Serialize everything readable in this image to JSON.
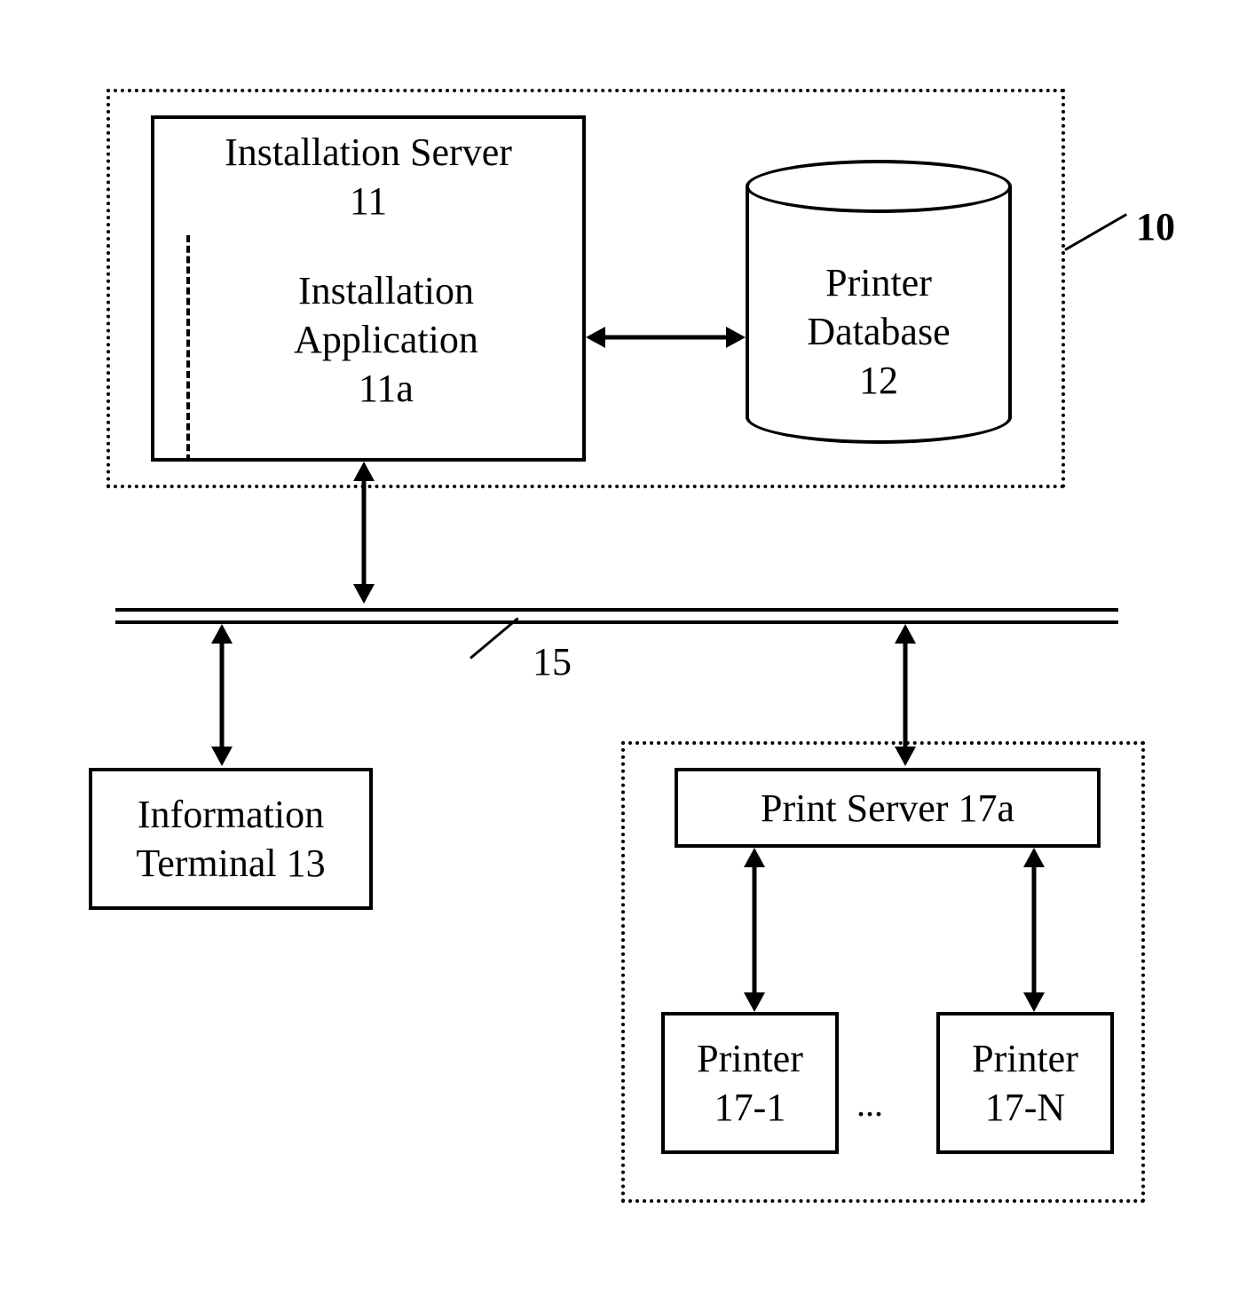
{
  "groups": {
    "system10": {
      "ref": "10"
    },
    "printGroup": {}
  },
  "installationServer": {
    "title": "Installation Server",
    "ref": "11"
  },
  "installationApp": {
    "title": "Installation",
    "title2": "Application",
    "ref": "11a"
  },
  "printerDb": {
    "title": "Printer",
    "title2": "Database",
    "ref": "12"
  },
  "bus": {
    "ref": "15"
  },
  "infoTerminal": {
    "title": "Information",
    "title2": "Terminal 13"
  },
  "printServer": {
    "title": "Print Server 17a"
  },
  "printer1": {
    "title": "Printer",
    "ref": "17-1"
  },
  "printerN": {
    "title": "Printer",
    "ref": "17-N"
  },
  "ellipsis": {
    "text": "..."
  }
}
